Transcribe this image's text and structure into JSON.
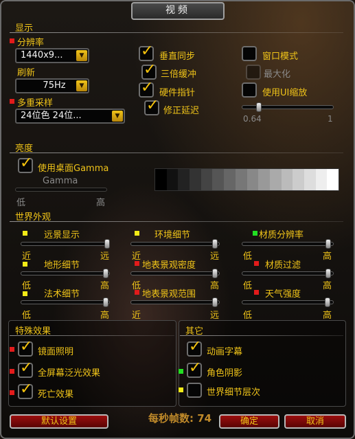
{
  "window": {
    "title": "视频"
  },
  "display": {
    "section_title": "显示",
    "resolution_label": "分辨率",
    "resolution_value": "1440x9...",
    "refresh_label": "刷新",
    "refresh_value": "75Hz",
    "multisample_label": "多重采样",
    "multisample_value": "24位色 24位...",
    "vsync": "垂直同步",
    "triple_buffer": "三倍缓冲",
    "hardware_cursor": "硬件指针",
    "fix_lag": "修正延迟",
    "windowed": "窗口模式",
    "maximized": "最大化",
    "ui_scale": "使用UI缩放",
    "ui_scale_min": "0.64",
    "ui_scale_max": "1"
  },
  "brightness": {
    "section_title": "亮度",
    "desktop_gamma": "使用桌面Gamma",
    "gamma_label": "Gamma",
    "low": "低",
    "high": "高"
  },
  "world": {
    "section_title": "世界外观",
    "view_distance": "远景显示",
    "view_near": "近",
    "view_far": "远",
    "environment_detail": "环境细节",
    "env_near": "近",
    "env_far": "远",
    "texture_resolution": "材质分辨率",
    "texres_low": "低",
    "texres_high": "高",
    "terrain_detail": "地形细节",
    "terrain_low": "低",
    "terrain_high": "高",
    "ground_clutter_density": "地表景观密度",
    "gcd_low": "低",
    "gcd_high": "高",
    "texture_filtering": "材质过滤",
    "filter_low": "低",
    "filter_high": "高",
    "spell_detail": "法术细节",
    "spell_low": "低",
    "spell_high": "高",
    "ground_clutter_radius": "地表景观范围",
    "gcr_near": "近",
    "gcr_far": "远",
    "weather_intensity": "天气强度",
    "weather_low": "低",
    "weather_high": "高"
  },
  "special_effects": {
    "section_title": "特殊效果",
    "specular": "镜面照明",
    "full_screen_glow": "全屏幕泛光效果",
    "death_effect": "死亡效果"
  },
  "other": {
    "section_title": "其它",
    "animated_subtitles": "动画字幕",
    "character_shadows": "角色阴影",
    "world_detail_levels": "世界细节层次"
  },
  "footer": {
    "defaults": "默认设置",
    "fps": "每秒帧数: 74",
    "ok": "确定",
    "cancel": "取消"
  },
  "slider_levels": {
    "ui_scale": 0.18,
    "gamma": 0.0,
    "view_distance": 0.98,
    "environment_detail": 0.95,
    "texture_resolution": 0.95,
    "terrain_detail": 0.96,
    "ground_clutter_density": 0.95,
    "texture_filtering": 0.95,
    "spell_detail": 0.96,
    "ground_clutter_radius": 0.95,
    "weather_intensity": 0.94
  },
  "colors": {
    "gold": "#f0c419",
    "button_red": "#8a0a0a",
    "indicator_red": "#e21b1b",
    "indicator_yellow": "#f2ea17",
    "indicator_green": "#22e022"
  }
}
